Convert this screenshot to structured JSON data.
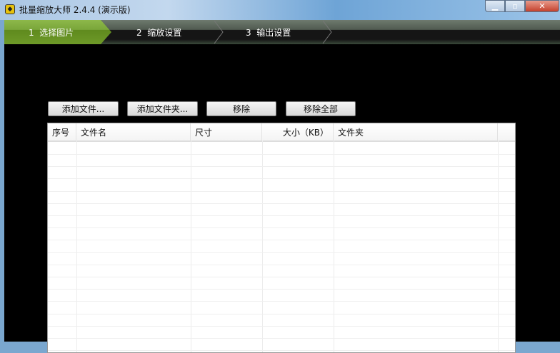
{
  "window": {
    "title": "批量缩放大师 2.4.4 (演示版)",
    "min": "▁",
    "max": "▫",
    "close": "✕"
  },
  "steps": [
    {
      "num": "1",
      "label": "选择图片"
    },
    {
      "num": "2",
      "label": "缩放设置"
    },
    {
      "num": "3",
      "label": "输出设置"
    }
  ],
  "toolbar": {
    "add_files": "添加文件...",
    "add_folder": "添加文件夹...",
    "remove": "移除",
    "remove_all": "移除全部"
  },
  "table": {
    "columns": [
      "序号",
      "文件名",
      "尺寸",
      "大小（KB）",
      "文件夹"
    ],
    "rows": []
  },
  "colors": {
    "active_step": "#7aa63a"
  }
}
